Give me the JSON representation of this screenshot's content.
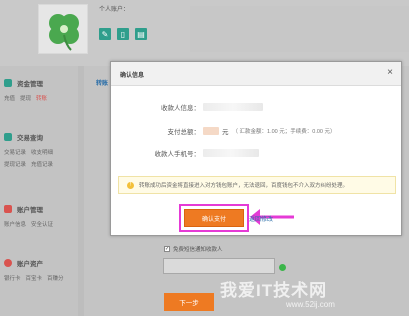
{
  "header": {
    "account_label": "个人账户：",
    "icons": [
      "edit-icon",
      "phone-icon",
      "card-icon"
    ]
  },
  "sidebar": {
    "sections": [
      {
        "title": "资金管理",
        "color": "#2f9e8c",
        "links": [
          [
            "充值",
            "提现",
            "转账"
          ]
        ]
      },
      {
        "title": "交易查询",
        "color": "#2f9e8c",
        "links": [
          [
            "交易记录",
            "收支明细"
          ],
          [
            "提现记录",
            "充值记录"
          ]
        ]
      },
      {
        "title": "账户管理",
        "color": "#d9534f",
        "links": [
          [
            "账户信息",
            "安全认证"
          ]
        ]
      },
      {
        "title": "账户资产",
        "color": "#d9534f",
        "links": [
          [
            "银行卡",
            "百宝卡",
            "百赚分"
          ]
        ]
      }
    ]
  },
  "main": {
    "tab_label": "转账"
  },
  "modal": {
    "title": "确认信息",
    "close_symbol": "×",
    "recipient_label": "收款人信息：",
    "amount_label": "支付总额：",
    "amount_unit": "元",
    "amount_detail": "（ 汇款金额：1.00 元；手续费：0.00 元）",
    "phone_label": "收款人手机号：",
    "tip_text": "转账成功后资金将直接进入对方钱包账户，无法退回，百度钱包不介入双方纠纷处理。",
    "confirm_label": "确认支付",
    "cancel_label": "返回修改"
  },
  "form": {
    "notify_text": "免费短信通知收款人",
    "next_label": "下一步"
  },
  "watermark": {
    "text": "我爱IT技术网",
    "url": "www.52ij.com"
  },
  "colors": {
    "accent": "#ee7a22",
    "highlight": "#e53ad6",
    "link": "#2a6ea8",
    "teal": "#2f9e8c"
  }
}
